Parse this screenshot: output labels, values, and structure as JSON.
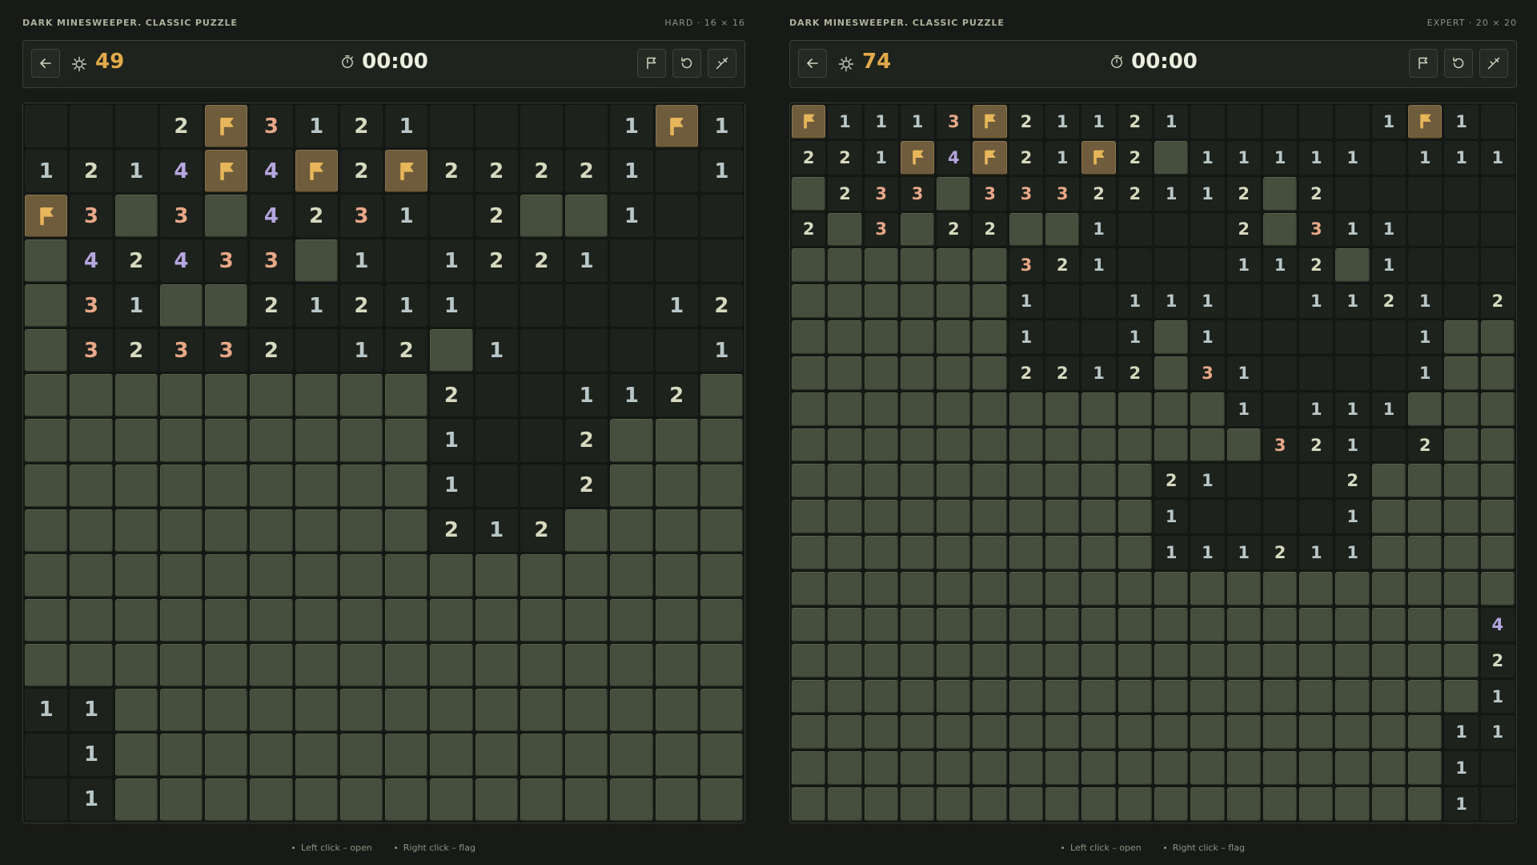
{
  "colors": {
    "n1": "#b9c6c7",
    "n2": "#d6d9bd",
    "n3": "#e8a887",
    "n4": "#b6a6e0",
    "flag": "#e7b55a",
    "accent": "#e2a94a"
  },
  "left": {
    "title": "DARK MINESWEEPER. CLASSIC PUZZLE",
    "mode": "HARD · 16 × 16",
    "mines": "49",
    "timer": "00:00",
    "hint_open": "Left click – open",
    "hint_flag": "Right click – flag",
    "rows": [
      "___2F3121____1F1_",
      "1214F4F2F22221 1",
      "F3#3#4231 2##1___",
      "#42433#1 1221____",
      "#31##21211____122",
      "#32332 12#1____1##",
      "#########2 _112##",
      "#########1 _2####",
      "#########1 _2####",
      "#########212####",
      "################",
      "################",
      "################",
      "11##############",
      "_1##############",
      "_1##############"
    ]
  },
  "right": {
    "title": "DARK MINESWEEPER. CLASSIC PUZZLE",
    "mode": "EXPERT · 20 × 20",
    "mines": "74",
    "timer": "00:00",
    "hint_open": "Left click – open",
    "hint_flag": "Right click – flag",
    "rows": [
      "F1113F21121_____1F1_",
      "221F4F21F2#11111_111",
      "#233#33322112#2_____",
      "2#3#22##1___2#311___",
      "######321___112#1___",
      "######1__111__1121_21",
      "######1__1#1_____1###",
      "######2212#31____1###",
      "############1_111####",
      "#############321_2####",
      "##########21___2#####",
      "##########1____1#####",
      "##########111211#####",
      "####################",
      "###################42",
      "###################2_",
      "###################1_",
      "##################11_",
      "##################1__",
      "##################1__"
    ]
  }
}
